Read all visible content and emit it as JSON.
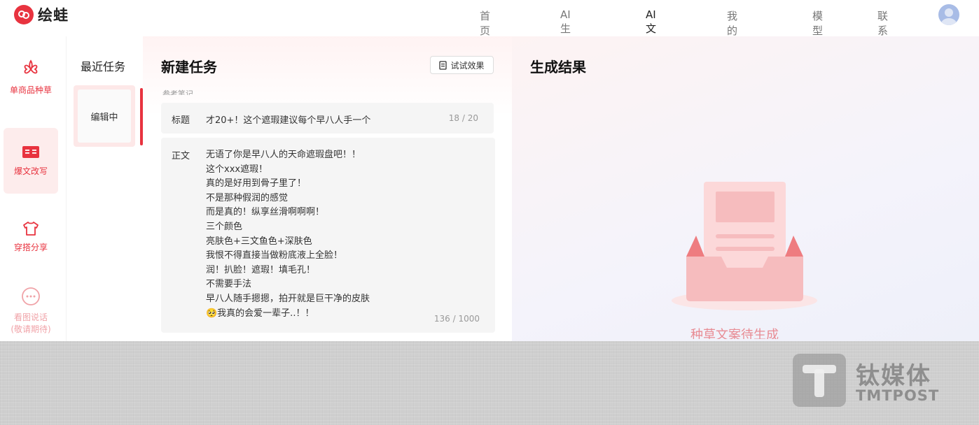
{
  "app": {
    "name": "绘蛙"
  },
  "nav": {
    "items": [
      {
        "label": "首页",
        "active": false
      },
      {
        "label": "AI生图",
        "active": false
      },
      {
        "label": "AI文案",
        "active": true
      },
      {
        "label": "我的作品",
        "active": false
      },
      {
        "label": "模型管理",
        "active": false
      },
      {
        "label": "联系我们",
        "active": false
      }
    ]
  },
  "rail": {
    "items": [
      {
        "label": "单商品种草",
        "icon": "clover-icon"
      },
      {
        "label": "爆文改写",
        "icon": "book-icon",
        "active": true
      },
      {
        "label": "穿搭分享",
        "icon": "shirt-icon"
      },
      {
        "label": "看图说话\n(敬请期待)",
        "icon": "chat-bubble-icon",
        "disabled": true
      }
    ]
  },
  "recent": {
    "title": "最近任务",
    "tasks": [
      {
        "status": "编辑中"
      }
    ]
  },
  "form": {
    "title": "新建任务",
    "try_label": "试试效果",
    "partial_label": "参考笔记",
    "title_field": {
      "label": "标题",
      "value": "才20+！这个遮瑕建议每个早八人手一个",
      "count": "18 / 20"
    },
    "body_field": {
      "label": "正文",
      "lines": [
        "无语了你是早八人的天命遮瑕盘吧！！",
        "这个xxx遮瑕！",
        "真的是好用到骨子里了！",
        "不是那种假润的感觉",
        "而是真的！纵享丝滑啊啊啊！",
        "三个颜色",
        "亮肤色+三文鱼色+深肤色",
        "我恨不得直接当做粉底液上全脸！",
        "润！扒脸！遮瑕！填毛孔！",
        "不需要手法",
        "早八人随手摁摁，拍开就是巨干净的皮肤",
        "🥺我真的会爱一辈子..！！"
      ],
      "count": "136 / 1000"
    }
  },
  "result": {
    "title": "生成结果",
    "waiting_text": "种草文案待生成"
  },
  "watermark": {
    "cn": "钛媒体",
    "en": "TMTPOST"
  },
  "colors": {
    "accent": "#e8333f",
    "accent_light": "#fdecec",
    "illustration": "#f6bcbe"
  }
}
